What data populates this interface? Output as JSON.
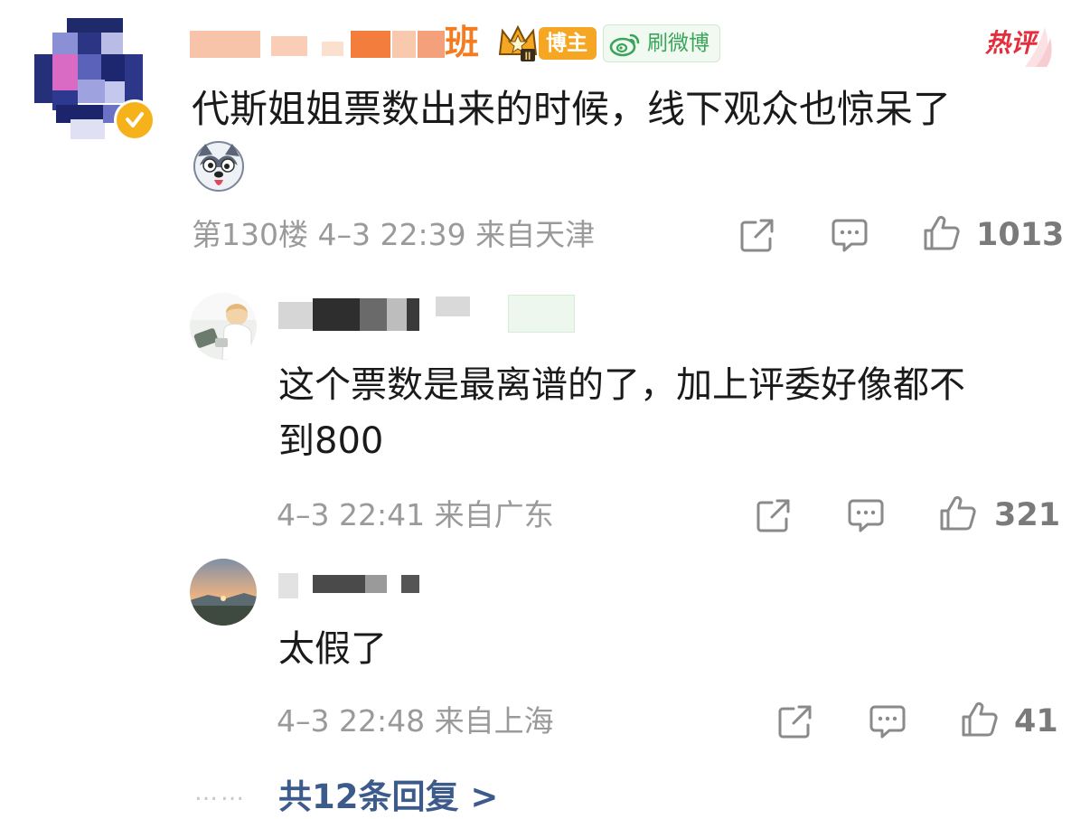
{
  "main_comment": {
    "username_suffix": "班",
    "blogger_badge": "博主",
    "weibo_chip_label": "刷微博",
    "hot_label": "热评",
    "text": "代斯姐姐票数出来的时候，线下观众也惊呆了",
    "floor": "第130楼",
    "time": "4–3 22:39",
    "location": "来自天津",
    "like_count": "1013",
    "icons": [
      "share-icon",
      "comment-icon",
      "like-icon",
      "crown-icon",
      "weibo-icon",
      "verified-icon",
      "husky-emoji-icon"
    ]
  },
  "replies": [
    {
      "text_line1": "这个票数是最离谱的了，加上评委好像都不",
      "text_line2": "到800",
      "time": "4–3 22:41",
      "location": "来自广东",
      "like_count": "321"
    },
    {
      "text_line1": "太假了",
      "time": "4–3 22:48",
      "location": "来自上海",
      "like_count": "41"
    }
  ],
  "more_replies": {
    "dots": "……",
    "label": "共12条回复 >"
  },
  "colors": {
    "meta_gray": "#9a9a9a",
    "hot_red": "#e62d3c",
    "link_blue": "#3d5b8a",
    "badge_orange": "#f5a623",
    "weibo_green": "#3aa45b"
  }
}
